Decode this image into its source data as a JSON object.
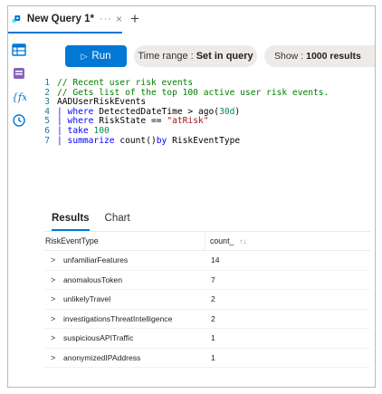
{
  "tab": {
    "title": "New Query 1*",
    "more": "···",
    "close": "×",
    "add": "+"
  },
  "rail": {
    "icons": [
      "table-icon",
      "database-icon",
      "function-icon",
      "history-icon"
    ]
  },
  "toolbar": {
    "run_label": "Run",
    "time_range_label": "Time range :",
    "time_range_value": "Set in query",
    "show_label": "Show :",
    "show_value": "1000 results"
  },
  "editor": {
    "lines": [
      {
        "num": "1",
        "comment": "// Recent user risk events"
      },
      {
        "num": "2",
        "comment": "// Gets list of the top 100 active user risk events."
      },
      {
        "num": "3",
        "text": "AADUserRiskEvents"
      },
      {
        "num": "4",
        "kw": "| where",
        "text": " DetectedDateTime > ago(",
        "num_lit": "30d",
        "text2": ")"
      },
      {
        "num": "5",
        "kw": "| where",
        "text": " RiskState == ",
        "str": "\"atRisk\""
      },
      {
        "num": "6",
        "kw": "| take",
        "text": " ",
        "num_lit": "100"
      },
      {
        "num": "7",
        "kw": "| summarize",
        "text": " count()",
        "kw2": "by",
        "text2": " RiskEventType"
      }
    ]
  },
  "results": {
    "tabs": [
      "Results",
      "Chart"
    ],
    "active_tab": "Results",
    "columns": [
      "RiskEventType",
      "count_"
    ],
    "rows": [
      {
        "type": "unfamiliarFeatures",
        "count": "14"
      },
      {
        "type": "anomalousToken",
        "count": "7"
      },
      {
        "type": "unlikelyTravel",
        "count": "2"
      },
      {
        "type": "investigationsThreatIntelligence",
        "count": "2"
      },
      {
        "type": "suspiciousAPITraffic",
        "count": "1"
      },
      {
        "type": "anonymizedIPAddress",
        "count": "1"
      }
    ]
  },
  "colors": {
    "accent": "#0078d4",
    "comment": "#008000",
    "keyword": "#0000ff",
    "string": "#a31515",
    "number": "#098658",
    "line_number": "#237893"
  }
}
